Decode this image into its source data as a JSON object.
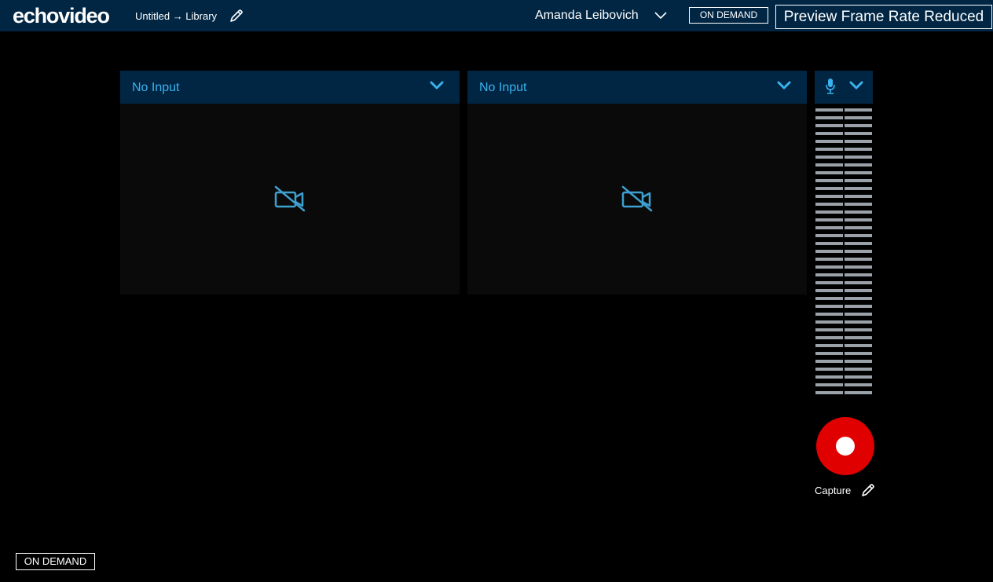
{
  "header": {
    "logo": "echovideo",
    "breadcrumb": "Untitled → Library",
    "user_name": "Amanda Leibovich",
    "mode_badge": "ON DEMAND",
    "frame_rate_notice": "Preview Frame Rate Reduced"
  },
  "sources": [
    {
      "label": "No Input"
    },
    {
      "label": "No Input"
    }
  ],
  "audio": {
    "icon": "microphone-icon",
    "meter_level": 0
  },
  "capture": {
    "label": "Capture"
  },
  "footer": {
    "mode_badge": "ON DEMAND"
  },
  "colors": {
    "header_bg": "#002644",
    "accent": "#3ab2ee",
    "record": "#e00000",
    "meter": "#9aa1a8"
  }
}
